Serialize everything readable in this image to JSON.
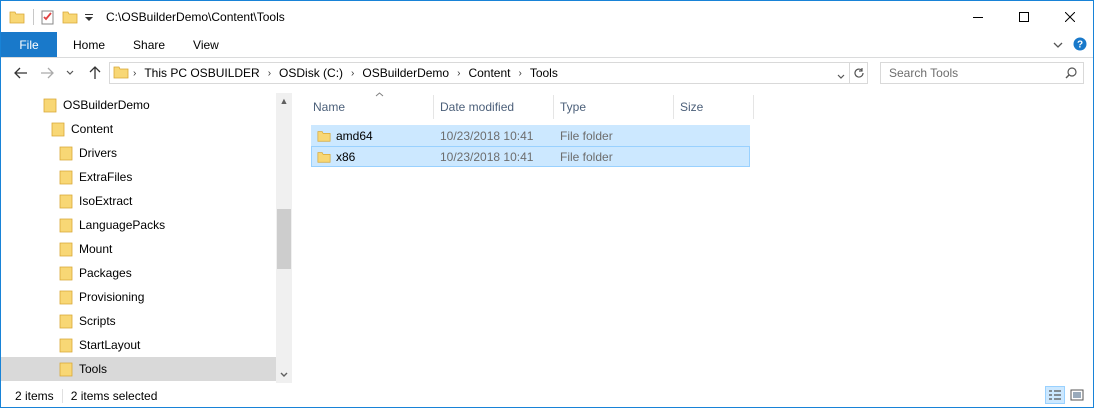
{
  "titlebar": {
    "title": "C:\\OSBuilderDemo\\Content\\Tools"
  },
  "ribbon": {
    "tabs": [
      "File",
      "Home",
      "Share",
      "View"
    ]
  },
  "address": {
    "crumbs": [
      "This PC OSBUILDER",
      "OSDisk (C:)",
      "OSBuilderDemo",
      "Content",
      "Tools"
    ]
  },
  "search": {
    "placeholder": "Search Tools"
  },
  "navpane": {
    "items": [
      {
        "label": "OSBuilderDemo",
        "indent": 1,
        "selected": false
      },
      {
        "label": "Content",
        "indent": 2,
        "selected": false
      },
      {
        "label": "Drivers",
        "indent": 3,
        "selected": false
      },
      {
        "label": "ExtraFiles",
        "indent": 3,
        "selected": false
      },
      {
        "label": "IsoExtract",
        "indent": 3,
        "selected": false
      },
      {
        "label": "LanguagePacks",
        "indent": 3,
        "selected": false
      },
      {
        "label": "Mount",
        "indent": 3,
        "selected": false
      },
      {
        "label": "Packages",
        "indent": 3,
        "selected": false
      },
      {
        "label": "Provisioning",
        "indent": 3,
        "selected": false
      },
      {
        "label": "Scripts",
        "indent": 3,
        "selected": false
      },
      {
        "label": "StartLayout",
        "indent": 3,
        "selected": false
      },
      {
        "label": "Tools",
        "indent": 3,
        "selected": true
      }
    ]
  },
  "content": {
    "columns": [
      "Name",
      "Date modified",
      "Type",
      "Size"
    ],
    "rows": [
      {
        "name": "amd64",
        "date": "10/23/2018 10:41",
        "type": "File folder",
        "size": ""
      },
      {
        "name": "x86",
        "date": "10/23/2018 10:41",
        "type": "File folder",
        "size": ""
      }
    ]
  },
  "status": {
    "count": "2 items",
    "selected": "2 items selected"
  },
  "colors": {
    "accent": "#1979ca",
    "selection": "#cce8ff",
    "folder": "#f8d775"
  }
}
